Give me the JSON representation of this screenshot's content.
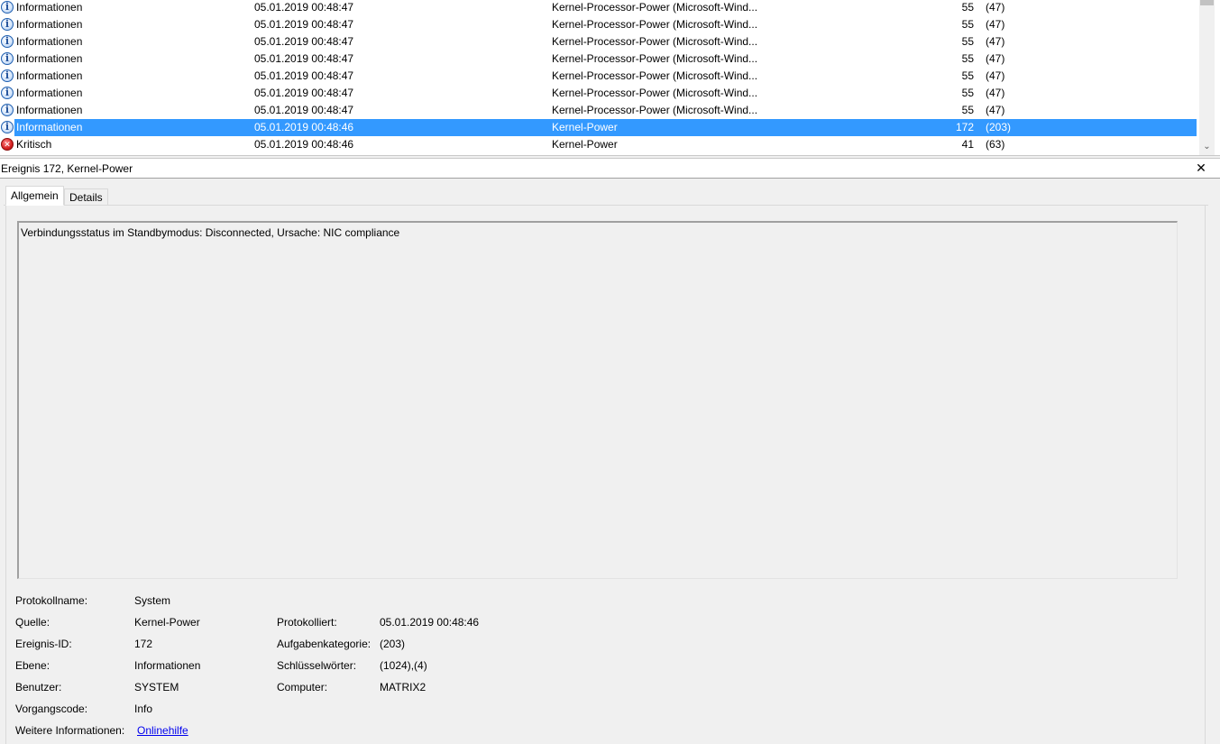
{
  "events": [
    {
      "level": "Informationen",
      "icon": "info",
      "date": "05.01.2019 00:48:47",
      "source": "Kernel-Processor-Power (Microsoft-Wind...",
      "id": "55",
      "task": "(47)"
    },
    {
      "level": "Informationen",
      "icon": "info",
      "date": "05.01.2019 00:48:47",
      "source": "Kernel-Processor-Power (Microsoft-Wind...",
      "id": "55",
      "task": "(47)"
    },
    {
      "level": "Informationen",
      "icon": "info",
      "date": "05.01.2019 00:48:47",
      "source": "Kernel-Processor-Power (Microsoft-Wind...",
      "id": "55",
      "task": "(47)"
    },
    {
      "level": "Informationen",
      "icon": "info",
      "date": "05.01.2019 00:48:47",
      "source": "Kernel-Processor-Power (Microsoft-Wind...",
      "id": "55",
      "task": "(47)"
    },
    {
      "level": "Informationen",
      "icon": "info",
      "date": "05.01.2019 00:48:47",
      "source": "Kernel-Processor-Power (Microsoft-Wind...",
      "id": "55",
      "task": "(47)"
    },
    {
      "level": "Informationen",
      "icon": "info",
      "date": "05.01.2019 00:48:47",
      "source": "Kernel-Processor-Power (Microsoft-Wind...",
      "id": "55",
      "task": "(47)"
    },
    {
      "level": "Informationen",
      "icon": "info",
      "date": "05.01.2019 00:48:47",
      "source": "Kernel-Processor-Power (Microsoft-Wind...",
      "id": "55",
      "task": "(47)"
    },
    {
      "level": "Informationen",
      "icon": "info",
      "date": "05.01.2019 00:48:46",
      "source": "Kernel-Power",
      "id": "172",
      "task": "(203)",
      "selected": true
    },
    {
      "level": "Kritisch",
      "icon": "critical",
      "date": "05.01.2019 00:48:46",
      "source": "Kernel-Power",
      "id": "41",
      "task": "(63)"
    }
  ],
  "details": {
    "title": "Ereignis 172, Kernel-Power",
    "close_glyph": "✕",
    "tabs": [
      "Allgemein",
      "Details"
    ],
    "description": "Verbindungsstatus im Standbymodus: Disconnected, Ursache: NIC compliance",
    "labels": {
      "log_name": "Protokollname:",
      "source": "Quelle:",
      "event_id": "Ereignis-ID:",
      "level": "Ebene:",
      "user": "Benutzer:",
      "opcode": "Vorgangscode:",
      "more_info": "Weitere Informationen:",
      "logged": "Protokolliert:",
      "task_category": "Aufgabenkategorie:",
      "keywords": "Schlüsselwörter:",
      "computer": "Computer:"
    },
    "values": {
      "log_name": "System",
      "source": "Kernel-Power",
      "event_id": "172",
      "level": "Informationen",
      "user": "SYSTEM",
      "opcode": "Info",
      "more_info_link": "Onlinehilfe",
      "logged": "05.01.2019 00:48:46",
      "task_category": "(203)",
      "keywords": "(1024),(4)",
      "computer": "MATRIX2"
    }
  },
  "colors": {
    "selection": "#3399ff",
    "panel_bg": "#f0f0f0",
    "link": "#0000ee"
  }
}
